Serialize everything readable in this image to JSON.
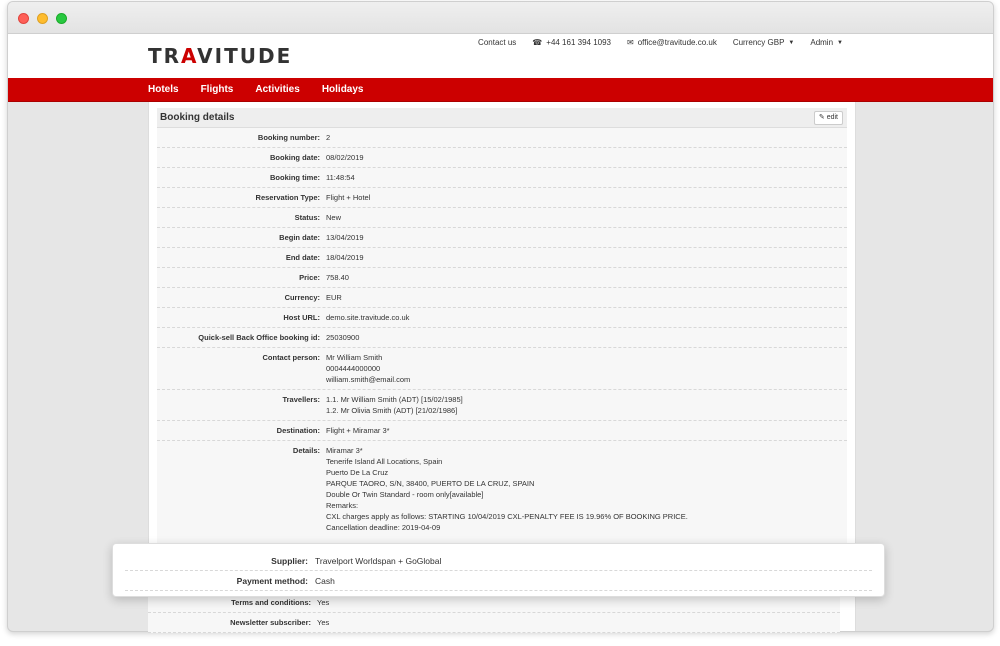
{
  "site": {
    "logo_text": "TRAVITUDE",
    "topbar": {
      "contact": "Contact us",
      "phone": "+44 161 394 1093",
      "email": "office@travitude.co.uk",
      "currency": "Currency GBP",
      "admin": "Admin"
    },
    "nav": [
      "Hotels",
      "Flights",
      "Activities",
      "Holidays"
    ]
  },
  "panel": {
    "title": "Booking details",
    "edit_label": "edit",
    "rows": [
      {
        "k": "Booking number:",
        "v": "2"
      },
      {
        "k": "Booking date:",
        "v": "08/02/2019"
      },
      {
        "k": "Booking time:",
        "v": "11:48:54"
      },
      {
        "k": "Reservation Type:",
        "v": "Flight + Hotel"
      },
      {
        "k": "Status:",
        "v": "New"
      },
      {
        "k": "Begin date:",
        "v": "13/04/2019"
      },
      {
        "k": "End date:",
        "v": "18/04/2019"
      },
      {
        "k": "Price:",
        "v": "758.40"
      },
      {
        "k": "Currency:",
        "v": "EUR"
      },
      {
        "k": "Host URL:",
        "v": "demo.site.travitude.co.uk"
      },
      {
        "k": "Quick-sell Back Office booking id:",
        "v": "25030900"
      },
      {
        "k": "Contact person:",
        "v": "Mr William Smith\n0004444000000\nwilliam.smith@email.com"
      },
      {
        "k": "Travellers:",
        "v": "1.1. Mr William Smith (ADT) [15/02/1985]\n1.2. Mr Olivia Smith (ADT) [21/02/1986]"
      },
      {
        "k": "Destination:",
        "v": "Flight + Miramar 3*"
      },
      {
        "k": "Details:",
        "v": "Miramar 3*\nTenerife Island All Locations, Spain\nPuerto De La Cruz\nPARQUE TAORO, S/N, 38400, PUERTO DE LA CRUZ, SPAIN\nDouble Or Twin Standard - room only[available]\nRemarks:\nCXL charges apply as follows: STARTING 10/04/2019 CXL-PENALTY FEE IS 19.96% OF BOOKING PRICE.\nCancellation deadline: 2019-04-09\n\nOutbound - 1 segment(s):\nMAN - TFS (2019-04-13T08:05 - 2019-04-13T12:45) [MT 1612]\n\nInbound - 1 segment(s):"
      }
    ]
  },
  "overlay": {
    "rows": [
      {
        "k": "Supplier:",
        "v": "Travelport Worldspan + GoGlobal"
      },
      {
        "k": "Payment method:",
        "v": "Cash"
      }
    ]
  },
  "bottom": {
    "rows": [
      {
        "k": "Terms and conditions:",
        "v": "Yes"
      },
      {
        "k": "Newsletter subscriber:",
        "v": "Yes"
      }
    ]
  }
}
